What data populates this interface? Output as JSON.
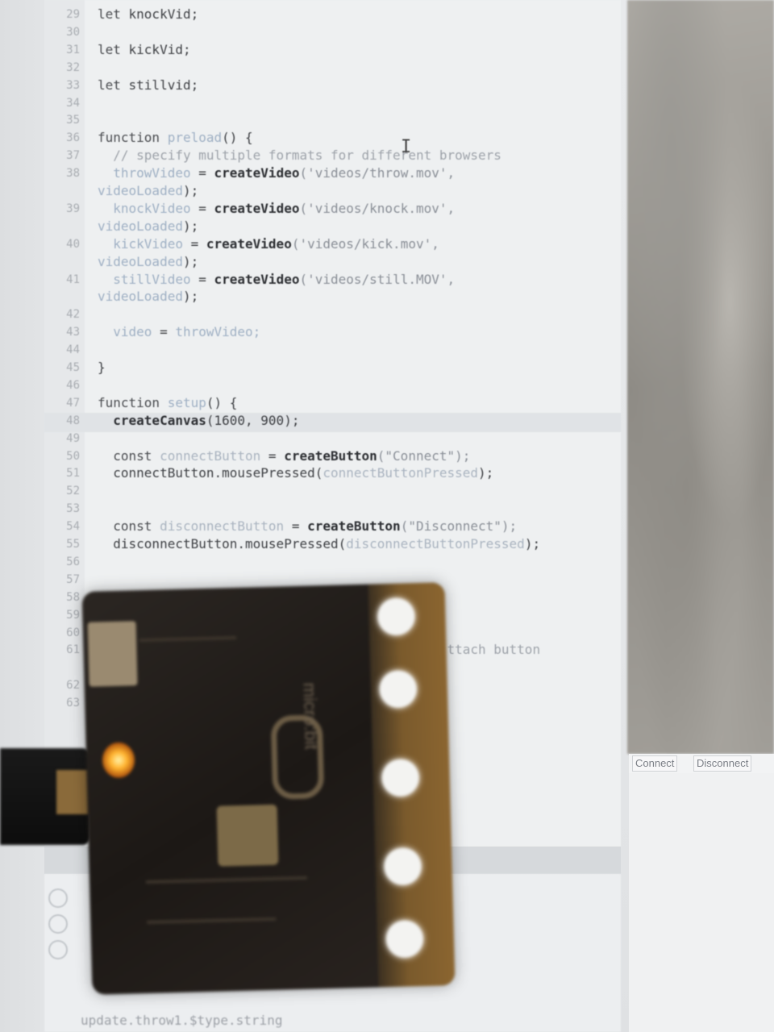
{
  "editor": {
    "lines": [
      {
        "n": "29",
        "tokens": [
          [
            "kw",
            "let "
          ],
          [
            "plain",
            "knockVid;"
          ]
        ]
      },
      {
        "n": "30",
        "tokens": []
      },
      {
        "n": "31",
        "tokens": [
          [
            "kw",
            "let "
          ],
          [
            "plain",
            "kickVid;"
          ]
        ]
      },
      {
        "n": "32",
        "tokens": []
      },
      {
        "n": "33",
        "tokens": [
          [
            "kw",
            "let "
          ],
          [
            "plain",
            "stillvid;"
          ]
        ]
      },
      {
        "n": "34",
        "tokens": []
      },
      {
        "n": "35",
        "tokens": []
      },
      {
        "n": "36",
        "tokens": [
          [
            "kw",
            "function "
          ],
          [
            "var",
            "preload"
          ],
          [
            "plain",
            "() {"
          ]
        ]
      },
      {
        "n": "37",
        "tokens": [
          [
            "cm",
            "  // specify multiple formats for different browsers"
          ]
        ]
      },
      {
        "n": "38",
        "tokens": [
          [
            "var",
            "  throwVideo "
          ],
          [
            "plain",
            "= "
          ],
          [
            "fn",
            "createVideo"
          ],
          [
            "str",
            "('videos/throw.mov',"
          ]
        ]
      },
      {
        "n": "",
        "tokens": [
          [
            "var",
            "videoLoaded"
          ],
          [
            "plain",
            ");"
          ]
        ]
      },
      {
        "n": "39",
        "tokens": [
          [
            "var",
            "  knockVideo "
          ],
          [
            "plain",
            "= "
          ],
          [
            "fn",
            "createVideo"
          ],
          [
            "str",
            "('videos/knock.mov',"
          ]
        ]
      },
      {
        "n": "",
        "tokens": [
          [
            "var",
            "videoLoaded"
          ],
          [
            "plain",
            ");"
          ]
        ]
      },
      {
        "n": "40",
        "tokens": [
          [
            "var",
            "  kickVideo "
          ],
          [
            "plain",
            "= "
          ],
          [
            "fn",
            "createVideo"
          ],
          [
            "str",
            "('videos/kick.mov',"
          ]
        ]
      },
      {
        "n": "",
        "tokens": [
          [
            "var",
            "videoLoaded"
          ],
          [
            "plain",
            ");"
          ]
        ]
      },
      {
        "n": "41",
        "tokens": [
          [
            "var",
            "  stillVideo "
          ],
          [
            "plain",
            "= "
          ],
          [
            "fn",
            "createVideo"
          ],
          [
            "str",
            "('videos/still.MOV',"
          ]
        ]
      },
      {
        "n": "",
        "tokens": [
          [
            "var",
            "videoLoaded"
          ],
          [
            "plain",
            ");"
          ]
        ]
      },
      {
        "n": "42",
        "tokens": []
      },
      {
        "n": "43",
        "tokens": [
          [
            "var",
            "  video "
          ],
          [
            "plain",
            "= "
          ],
          [
            "var",
            "throwVideo;"
          ]
        ]
      },
      {
        "n": "44",
        "tokens": []
      },
      {
        "n": "45",
        "tokens": [
          [
            "plain",
            "}"
          ]
        ]
      },
      {
        "n": "46",
        "tokens": []
      },
      {
        "n": "47",
        "tokens": [
          [
            "kw",
            "function "
          ],
          [
            "var",
            "setup"
          ],
          [
            "plain",
            "() {"
          ]
        ]
      },
      {
        "n": "48",
        "tokens": [
          [
            "fn",
            "  createCanvas"
          ],
          [
            "plain",
            "(1600, 900);"
          ]
        ]
      },
      {
        "n": "49",
        "tokens": []
      },
      {
        "n": "50",
        "tokens": [
          [
            "kw",
            "  const "
          ],
          [
            "faded",
            "connectButton "
          ],
          [
            "plain",
            "= "
          ],
          [
            "fn",
            "createButton"
          ],
          [
            "str",
            "(\"Connect\");"
          ]
        ]
      },
      {
        "n": "51",
        "tokens": [
          [
            "plain",
            "  connectButton.mousePressed("
          ],
          [
            "faded",
            "connectButtonPressed"
          ],
          [
            "plain",
            ");"
          ]
        ]
      },
      {
        "n": "52",
        "tokens": []
      },
      {
        "n": "53",
        "tokens": []
      },
      {
        "n": "54",
        "tokens": [
          [
            "kw",
            "  const "
          ],
          [
            "faded",
            "disconnectButton "
          ],
          [
            "plain",
            "= "
          ],
          [
            "fn",
            "createButton"
          ],
          [
            "str",
            "(\"Disconnect\");"
          ]
        ]
      },
      {
        "n": "55",
        "tokens": [
          [
            "plain",
            "  disconnectButton.mousePressed("
          ],
          [
            "faded",
            "disconnectButtonPressed"
          ],
          [
            "plain",
            ");"
          ]
        ]
      },
      {
        "n": "56",
        "tokens": []
      },
      {
        "n": "57",
        "tokens": []
      },
      {
        "n": "58",
        "tokens": []
      },
      {
        "n": "59",
        "tokens": []
      },
      {
        "n": "60",
        "tokens": []
      },
      {
        "n": "61",
        "tokens": [
          [
            "cm",
            "                                             ttach button"
          ]
        ]
      },
      {
        "n": "",
        "tokens": []
      },
      {
        "n": "62",
        "tokens": []
      },
      {
        "n": "63",
        "tokens": []
      }
    ]
  },
  "console": {
    "last_line": "update.throw1.$type.string"
  },
  "preview": {
    "buttons": [
      "Connect",
      "Disconnect"
    ]
  },
  "device": {
    "label": "micro:bit"
  }
}
